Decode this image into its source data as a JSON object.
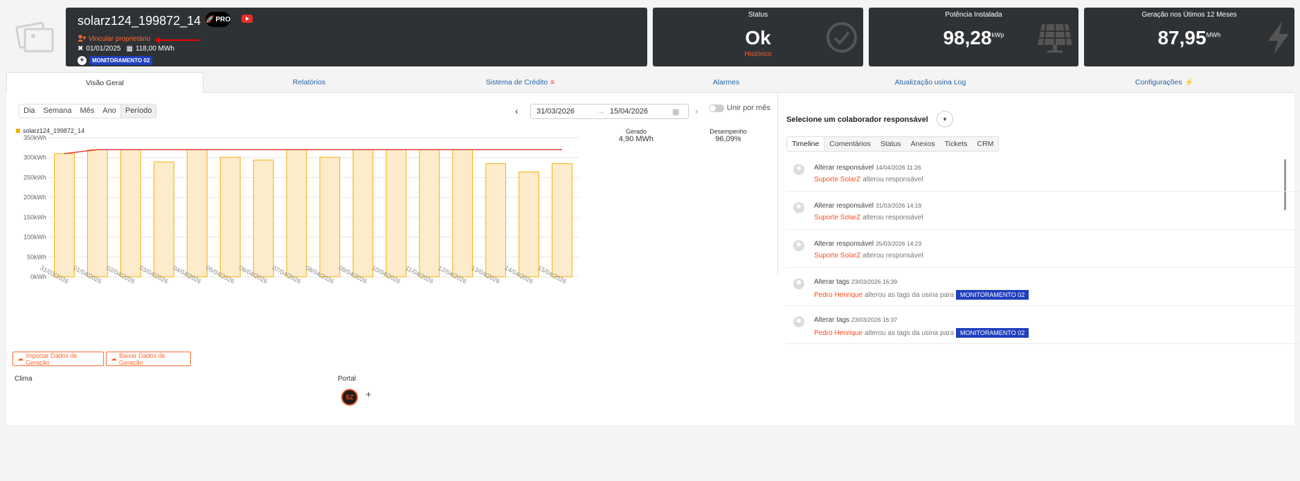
{
  "header": {
    "plant_name": "solarz124_199872_14",
    "pro_label": "PRO",
    "link_owner": "Vincular proprietário",
    "install_date": "01/01/2025",
    "expected": "118,00 MWh",
    "tag": "MONITORAMENTO 02"
  },
  "stats": {
    "status": {
      "title": "Status",
      "value": "Ok",
      "sub": "Histórico"
    },
    "power": {
      "title": "Potência Instalada",
      "value": "98,28",
      "unit": "kWp"
    },
    "generation": {
      "title": "Geração nos Útimos 12 Meses",
      "value": "87,95",
      "unit": "MWh"
    }
  },
  "tabs": [
    "Visão Geral",
    "Relatórios",
    "Sistema de Crédito",
    "Alarmes",
    "Atualização usina Log",
    "Configurações"
  ],
  "period": [
    "Dia",
    "Semana",
    "Mês",
    "Ano",
    "Período"
  ],
  "date_range": {
    "from": "31/03/2026",
    "to": "15/04/2026",
    "arrow": "→"
  },
  "toggle_label": "Unir por mês",
  "kpis": {
    "gerado_label": "Gerado",
    "gerado_value": "4,90 MWh",
    "desempenho_label": "Desempenho",
    "desempenho_value": "96,09%"
  },
  "chart_data": {
    "type": "bar",
    "legend": "solarz124_199872_14",
    "categories": [
      "31/03/2026",
      "01/04/2026",
      "02/04/2026",
      "03/04/2026",
      "04/04/2026",
      "05/04/2026",
      "06/04/2026",
      "07/04/2026",
      "08/04/2026",
      "09/04/2026",
      "10/04/2026",
      "11/04/2026",
      "12/04/2026",
      "13/04/2026",
      "14/04/2026",
      "15/04/2026"
    ],
    "values": [
      310,
      320,
      320,
      289,
      320,
      301,
      294,
      320,
      301,
      320,
      320,
      320,
      320,
      285,
      264,
      285
    ],
    "expected_line": [
      310,
      320,
      320,
      320,
      320,
      320,
      320,
      320,
      320,
      320,
      320,
      320,
      320,
      320,
      320,
      320
    ],
    "yticks": [
      "0kWh",
      "50kWh",
      "100kWh",
      "150kWh",
      "200kWh",
      "250kWh",
      "300kWh",
      "350kWh"
    ],
    "ylim": [
      0,
      350
    ],
    "bar_color": "#fdeccb",
    "bar_border": "#f5b000",
    "line_color": "#e23b3b"
  },
  "buttons": {
    "import": "Importar Dados de Geração",
    "download": "Baixar Dados de Geração"
  },
  "sections": {
    "clima": "Clima",
    "portal": "Portal",
    "portal_logo": "SZ"
  },
  "right": {
    "collab_title": "Selecione um colaborador responsável",
    "subtabs": [
      "Timeline",
      "Comentários",
      "Status",
      "Anexos",
      "Tickets",
      "CRM"
    ],
    "timeline": [
      {
        "title": "Alterar responsável",
        "date": "14/04/2026 11:26",
        "user": "Suporte SolarZ",
        "action": "alterou responsável",
        "tag": ""
      },
      {
        "title": "Alterar responsável",
        "date": "31/03/2026 14:19",
        "user": "Suporte SolarZ",
        "action": "alterou responsável",
        "tag": ""
      },
      {
        "title": "Alterar responsável",
        "date": "25/03/2026 14:23",
        "user": "Suporte SolarZ",
        "action": "alterou responsável",
        "tag": ""
      },
      {
        "title": "Alterar tags",
        "date": "23/03/2026 16:39",
        "user": "Pedro Henrique",
        "action": "alterou as tags da usina para",
        "tag": "MONITORAMENTO 02"
      },
      {
        "title": "Alterar tags",
        "date": "23/03/2026 16:37",
        "user": "Pedro Henrique",
        "action": "alterou as tags da usina para",
        "tag": "MONITORAMENTO 02"
      }
    ]
  }
}
